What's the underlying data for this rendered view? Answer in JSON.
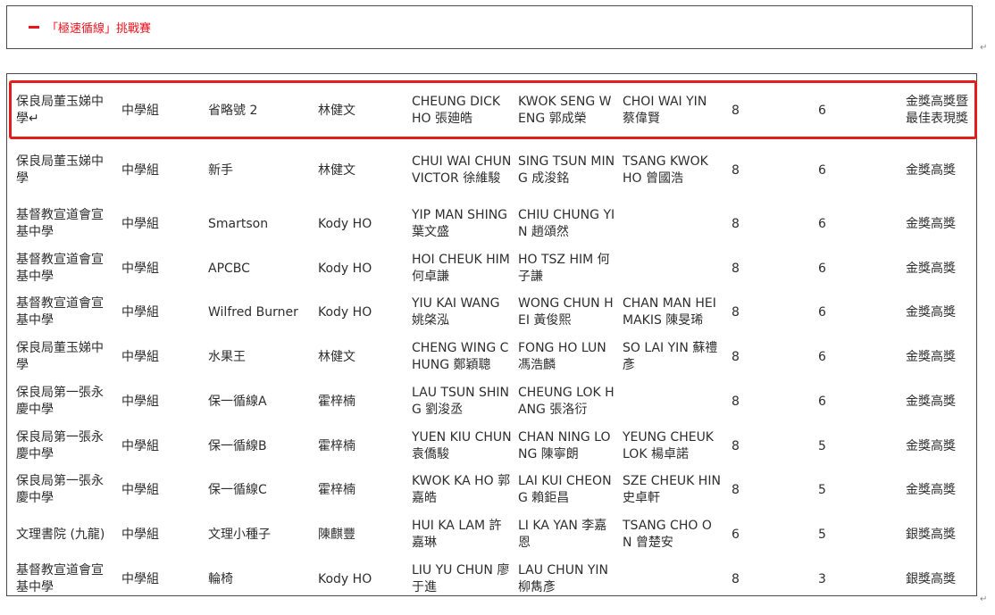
{
  "header": {
    "title": "「極速循線」挑戰賽"
  },
  "paragraph_mark": "↵",
  "rows": [
    {
      "school": "保良局董玉娣中學↵",
      "level": "中學組",
      "team": "省略號 2",
      "teacher": "林健文",
      "member1": "CHEUNG DICK HO 張廸皓",
      "member2": "KWOK SENG WENG 郭成榮",
      "member3": "CHOI WAI YIN 蔡偉賢",
      "score1": "8",
      "score2": "6",
      "award": "金獎高獎暨\n最佳表現獎"
    },
    {
      "school": "保良局董玉娣中學",
      "level": "中學組",
      "team": "新手",
      "teacher": "林健文",
      "member1": "CHUI WAI CHUN VICTOR 徐維駿",
      "member2": "SING TSUN MING 成浚銘",
      "member3": "TSANG KWOK HO 曾國浩",
      "score1": "8",
      "score2": "6",
      "award": "金獎高獎"
    },
    {
      "school": "基督教宣道會宣基中學",
      "level": "中學組",
      "team": "Smartson",
      "teacher": "Kody HO",
      "member1": "YIP MAN SHING 葉文盛",
      "member2": "CHIU CHUNG YIN 趙頌然",
      "member3": "",
      "score1": "8",
      "score2": "6",
      "award": "金獎高獎"
    },
    {
      "school": "基督教宣道會宣基中學",
      "level": "中學組",
      "team": "APCBC",
      "teacher": "Kody HO",
      "member1": "HOI CHEUK HIM 何卓謙",
      "member2": "HO TSZ HIM 何子謙",
      "member3": "",
      "score1": "8",
      "score2": "6",
      "award": "金獎高獎"
    },
    {
      "school": "基督教宣道會宣基中學",
      "level": "中學組",
      "team": "Wilfred Burner",
      "teacher": "Kody HO",
      "member1": "YIU KAI WANG 姚棨泓",
      "member2": "WONG CHUN HEI 黃俊熙",
      "member3": "CHAN MAN HEI MAKIS 陳旻琋",
      "score1": "8",
      "score2": "6",
      "award": "金獎高獎"
    },
    {
      "school": "保良局董玉娣中學",
      "level": "中學組",
      "team": "水果王",
      "teacher": "林健文",
      "member1": "CHENG WING CHUNG 鄭穎聰",
      "member2": "FONG HO LUN 馮浩麟",
      "member3": "SO LAI YIN 蘇禮彥",
      "score1": "8",
      "score2": "6",
      "award": "金獎高獎"
    },
    {
      "school": "保良局第一張永慶中學",
      "level": "中學組",
      "team": "保一循線A",
      "teacher": "霍梓楠",
      "member1": "LAU TSUN SHING 劉浚丞",
      "member2": "CHEUNG LOK HANG 張洛衍",
      "member3": "",
      "score1": "8",
      "score2": "6",
      "award": "金獎高獎"
    },
    {
      "school": "保良局第一張永慶中學",
      "level": "中學組",
      "team": "保一循線B",
      "teacher": "霍梓楠",
      "member1": "YUEN KIU CHUN 袁僑駿",
      "member2": "CHAN NING LONG 陳寧朗",
      "member3": "YEUNG CHEUK LOK 楊卓諾",
      "score1": "8",
      "score2": "5",
      "award": "金獎高獎"
    },
    {
      "school": "保良局第一張永慶中學",
      "level": "中學組",
      "team": "保一循線C",
      "teacher": "霍梓楠",
      "member1": "KWOK KA HO 郭嘉皓",
      "member2": "LAI KUI CHEONG 賴鉅昌",
      "member3": "SZE CHEUK HIN 史卓軒",
      "score1": "8",
      "score2": "5",
      "award": "金獎高獎"
    },
    {
      "school": "文理書院 (九龍)",
      "level": "中學組",
      "team": "文理小種子",
      "teacher": "陳麒豐",
      "member1": "HUI KA LAM 許嘉琳",
      "member2": "LI KA YAN 李嘉恩",
      "member3": "TSANG CHO ON 曾楚安",
      "score1": "6",
      "score2": "5",
      "award": "銀獎高獎"
    },
    {
      "school": "基督教宣道會宣基中學",
      "level": "中學組",
      "team": "輪椅",
      "teacher": "Kody HO",
      "member1": "LIU YU CHUN 廖于進",
      "member2": "LAU CHUN YIN 柳雋彥",
      "member3": "",
      "score1": "8",
      "score2": "3",
      "award": "銀獎高獎"
    }
  ],
  "colors": {
    "accent": "#e8141e",
    "highlight_border": "#e31c1c",
    "text": "#2e2e2e"
  }
}
